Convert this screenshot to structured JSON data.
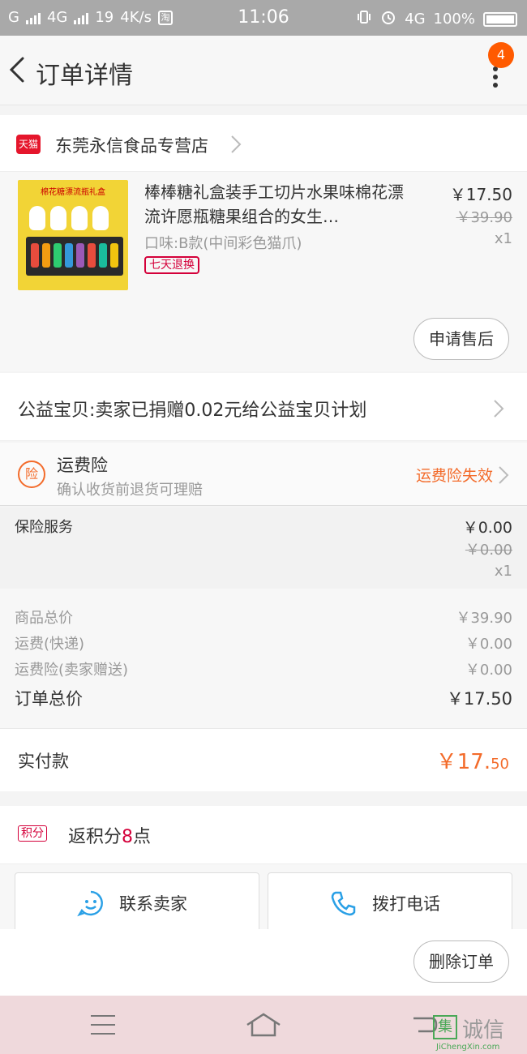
{
  "status_bar": {
    "carrier": "G",
    "net1": "4G",
    "net2": "19",
    "speed": "4K/s",
    "app_icon_text": "淘",
    "time": "11:06",
    "net_right": "4G",
    "battery": "100%"
  },
  "header": {
    "title": "订单详情",
    "badge_count": "4"
  },
  "shop": {
    "logo_text": "天猫",
    "name": "东莞永信食品专营店"
  },
  "product": {
    "image_label": "棉花糖漂流瓶礼盒",
    "name": "棒棒糖礼盒装手工切片水果味棉花漂流许愿瓶糖果组合的女生…",
    "spec": "口味:B款(中间彩色猫爪)",
    "return_tag": "七天退换",
    "price": "￥17.50",
    "old_price": "￥39.90",
    "qty": "x1",
    "aftersale_button": "申请售后"
  },
  "charity": {
    "text": "公益宝贝:卖家已捐赠0.02元给公益宝贝计划"
  },
  "freight_insurance": {
    "icon_text": "险",
    "title": "运费险",
    "subtitle": "确认收货前退货可理赔",
    "status": "运费险失效"
  },
  "insurance_service": {
    "label": "保险服务",
    "price": "￥0.00",
    "old_price": "￥0.00",
    "qty": "x1"
  },
  "summary": {
    "rows": [
      {
        "label": "商品总价",
        "value": "￥39.90"
      },
      {
        "label": "运费(快递)",
        "value": "￥0.00"
      },
      {
        "label": "运费险(卖家赠送)",
        "value": "￥0.00"
      }
    ],
    "total_label": "订单总价",
    "total_value": "￥17.50"
  },
  "paid": {
    "label": "实付款",
    "amount_main": "￥17.",
    "amount_cents": "50"
  },
  "points": {
    "tag": "积分",
    "text_prefix": "返积分",
    "number": "8",
    "text_suffix": "点"
  },
  "contacts": {
    "seller_label": "联系卖家",
    "phone_label": "拨打电话"
  },
  "actions": {
    "delete_label": "删除订单"
  },
  "watermark": {
    "logo_text": "集",
    "cn": "诚信",
    "en": "JiChengXin.com"
  },
  "colors": {
    "accent_orange": "#f36b2a",
    "tmall_red": "#e5162c",
    "badge_orange": "#ff5a00",
    "point_red": "#d4003a"
  }
}
